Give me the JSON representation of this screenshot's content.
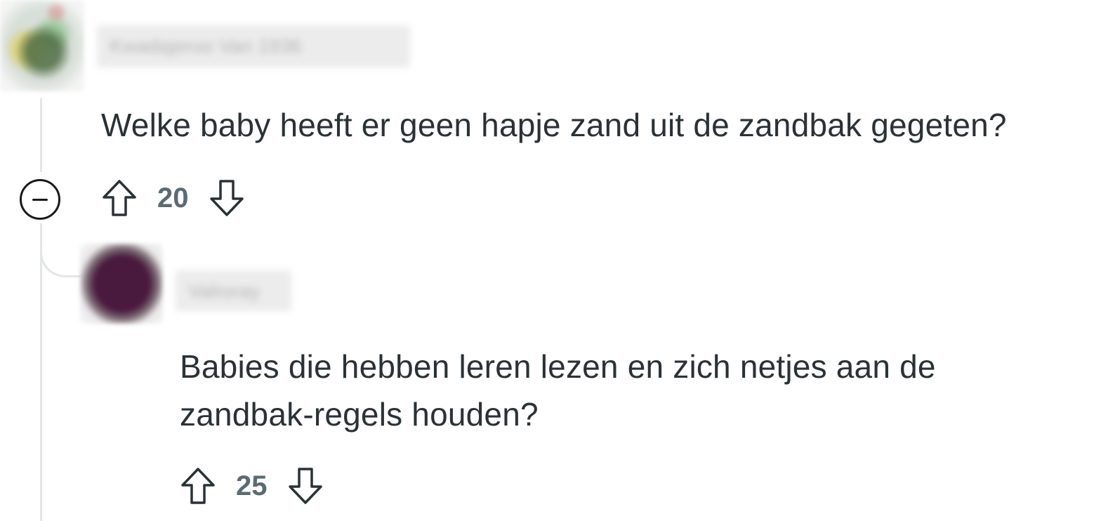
{
  "thread": {
    "parent_comment": {
      "username": "Kwadajeroo Van 1936",
      "body": "Welke baby heeft er geen hapje zand uit de zandbak gegeten?",
      "score": "20",
      "upvote_icon": "arrow-up-icon",
      "downvote_icon": "arrow-down-icon",
      "collapse_icon": "minus-circle-icon"
    },
    "reply_comment": {
      "username": "Valroray",
      "body_line1": "Babies die hebben leren lezen en zich netjes aan de",
      "body_line2": "zandbak-regels houden?",
      "score": "25",
      "upvote_icon": "arrow-up-icon",
      "downvote_icon": "arrow-down-icon"
    }
  },
  "colors": {
    "text": "#2a3236",
    "vote_count": "#5b6b73",
    "thread_line": "#e3e6e8",
    "icon_stroke": "#2a3236"
  }
}
